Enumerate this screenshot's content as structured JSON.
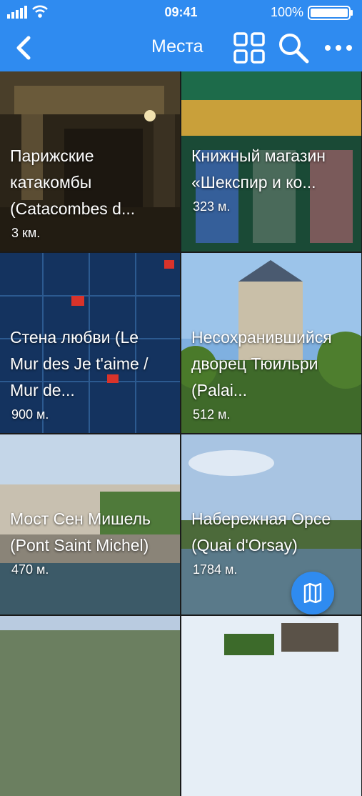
{
  "status_bar": {
    "time": "09:41",
    "battery": "100%"
  },
  "navbar": {
    "title": "Места"
  },
  "places": [
    {
      "name": "Парижские катакомбы (Catacombes d...",
      "distance": "3 км."
    },
    {
      "name": "Книжный магазин «Шекспир и ко...",
      "distance": "323 м."
    },
    {
      "name": "Стена любви (Le Mur des Je t'aime / Mur de...",
      "distance": "900 м."
    },
    {
      "name": "Несохранившийся дворец Тюильри (Palai...",
      "distance": "512 м."
    },
    {
      "name": "Мост Сен Мишель (Pont Saint Michel)",
      "distance": "470 м."
    },
    {
      "name": "Набережная Орсе (Quai d'Orsay)",
      "distance": "1784 м."
    }
  ],
  "colors": {
    "accent": "#2f8bf0"
  },
  "icons": [
    "back-chevron-icon",
    "grid-view-icon",
    "search-icon",
    "more-icon",
    "map-icon"
  ]
}
